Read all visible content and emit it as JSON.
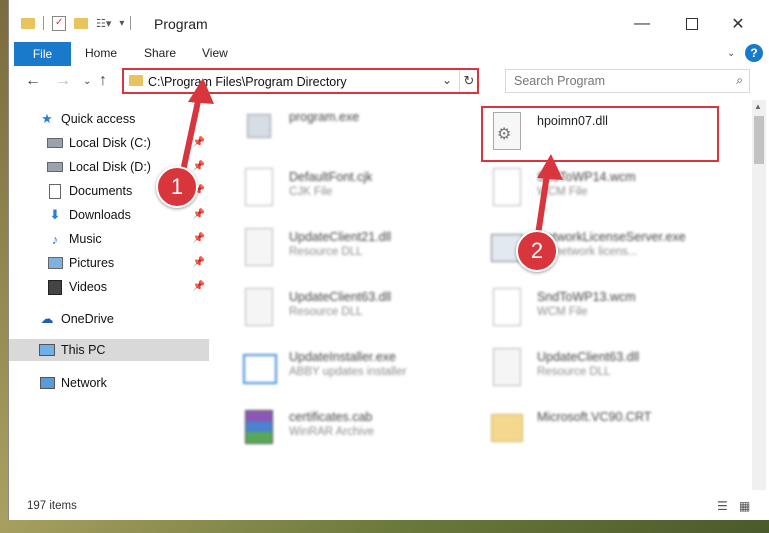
{
  "window": {
    "title": "Program"
  },
  "ribbon": {
    "file": "File",
    "home": "Home",
    "share": "Share",
    "view": "View",
    "help": "?"
  },
  "nav": {
    "address": "C:\\Program Files\\Program Directory",
    "search_placeholder": "Search Program"
  },
  "sidebar": {
    "items": [
      {
        "label": "Quick access",
        "icon": "star-icon"
      },
      {
        "label": "Local Disk (C:)",
        "icon": "drive-icon"
      },
      {
        "label": "Local Disk (D:)",
        "icon": "drive-icon"
      },
      {
        "label": "Documents",
        "icon": "documents-icon"
      },
      {
        "label": "Downloads",
        "icon": "download-icon"
      },
      {
        "label": "Music",
        "icon": "music-icon"
      },
      {
        "label": "Pictures",
        "icon": "pictures-icon"
      },
      {
        "label": "Videos",
        "icon": "videos-icon"
      },
      {
        "label": "OneDrive",
        "icon": "cloud-icon"
      },
      {
        "label": "This PC",
        "icon": "computer-icon"
      },
      {
        "label": "Network",
        "icon": "network-icon"
      }
    ]
  },
  "files": {
    "left": [
      {
        "name": "program.exe",
        "type": ""
      },
      {
        "name": "DefaultFont.cjk",
        "type": "CJK File"
      },
      {
        "name": "UpdateClient21.dll",
        "type": "Resource DLL"
      },
      {
        "name": "UpdateClient63.dll",
        "type": "Resource DLL"
      },
      {
        "name": "UpdateInstaller.exe",
        "type": "ABBY updates installer"
      },
      {
        "name": "certificates.cab",
        "type": "WinRAR Archive"
      }
    ],
    "right": [
      {
        "name": "hpoimn07.dll",
        "type": ""
      },
      {
        "name": "SndToWP14.wcm",
        "type": "WCM File"
      },
      {
        "name": "NetworkLicenseServer.exe",
        "type": "EF network licens..."
      },
      {
        "name": "SndToWP13.wcm",
        "type": "WCM File"
      },
      {
        "name": "UpdateClient63.dll",
        "type": "Resource DLL"
      },
      {
        "name": "Microsoft.VC90.CRT",
        "type": ""
      }
    ]
  },
  "status": {
    "count": "197 items"
  },
  "callouts": {
    "one": "1",
    "two": "2"
  },
  "colors": {
    "accent": "#1979ca",
    "highlight": "#d9353d"
  }
}
